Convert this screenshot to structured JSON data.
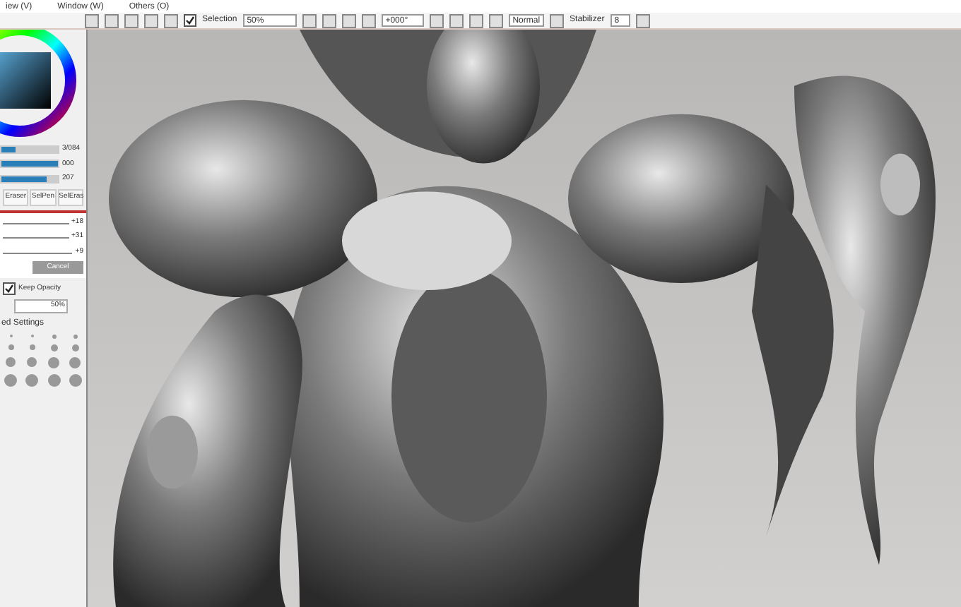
{
  "menu": [
    "iew (V)",
    "Window (W)",
    "Others (O)"
  ],
  "toolbar": {
    "selection": {
      "label": "Selection",
      "checked": true
    },
    "zoom": "50%",
    "angle": "+000°",
    "blend": "Normal",
    "stabilizer_label": "Stabilizer",
    "stabilizer": "8"
  },
  "color_panel": {
    "sliders": [
      {
        "reading": "3/084",
        "level": 0.25
      },
      {
        "reading": "000",
        "level": 1
      },
      {
        "reading": "207",
        "level": 0.81
      }
    ]
  },
  "tools": [
    {
      "label": "Eraser",
      "selected": false
    },
    {
      "label": "SelPen",
      "selected": false
    },
    {
      "label": "SelEras",
      "selected": false
    }
  ],
  "dialog": {
    "values": [
      "+18",
      "+31",
      "+9"
    ],
    "cancel": "Cancel"
  },
  "brush": {
    "keep_opacity": {
      "label": "Keep Opacity",
      "checked": true
    },
    "density": "50%",
    "section": "ed Settings"
  }
}
